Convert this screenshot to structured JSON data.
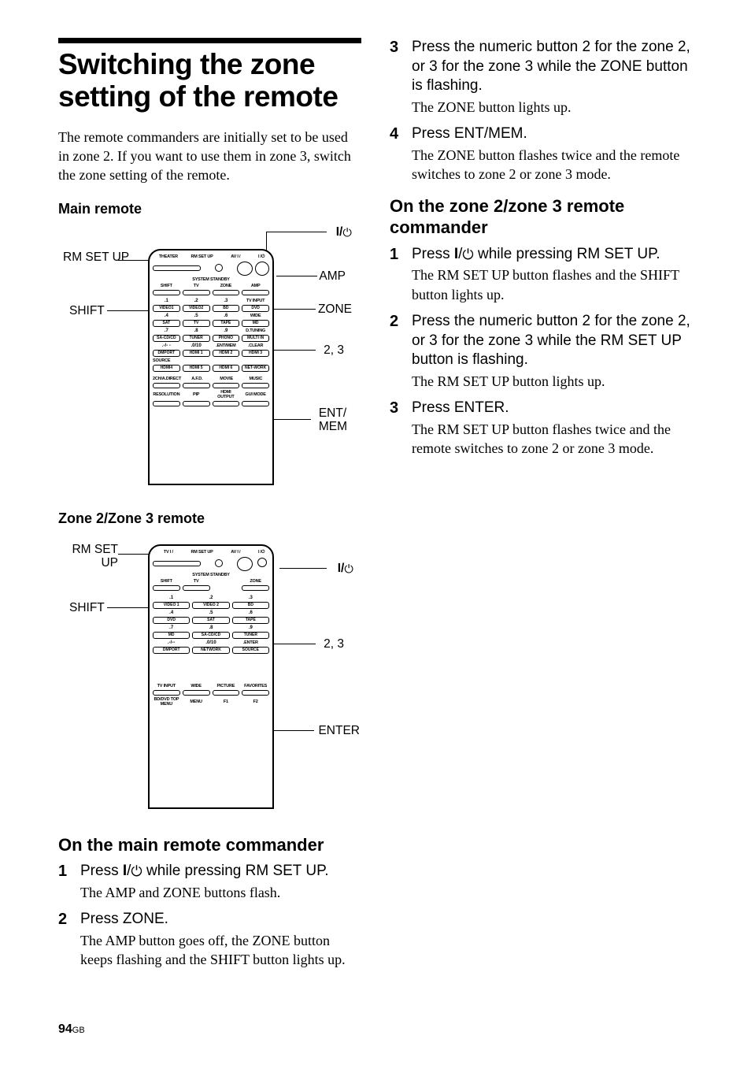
{
  "page_number": "94",
  "page_region": "GB",
  "left": {
    "title": "Switching the zone setting of the remote",
    "intro": "The remote commanders are initially set to be used in zone 2. If you want to use them in zone 3, switch the zone setting of the remote.",
    "main_remote_heading": "Main remote",
    "zone_remote_heading": "Zone 2/Zone 3 remote",
    "section_main_cmd": "On the main remote commander",
    "steps_main": [
      {
        "n": "1",
        "instr_pre": "Press ",
        "instr_bold": "I",
        "instr_post": "/",
        "instr_tail": " while pressing RM SET UP.",
        "result": "The AMP and ZONE buttons flash."
      },
      {
        "n": "2",
        "instr": "Press ZONE.",
        "result": "The AMP button goes off, the ZONE button keeps flashing and the SHIFT button lights up."
      }
    ],
    "fig1": {
      "labels": {
        "power": "I/",
        "rmsetup": "RM SET UP",
        "amp": "AMP",
        "shift": "SHIFT",
        "zone": "ZONE",
        "num": "2, 3",
        "entmem": "ENT/MEM"
      },
      "buttons": {
        "top_labels": [
          "THEATER",
          "RM SET UP",
          "AV I /",
          "SYSTEM STANDBY"
        ],
        "row_labels": [
          "SHIFT",
          "TV",
          "ZONE",
          "AMP"
        ],
        "nums": [
          ".1",
          ".2",
          ".3",
          "TV INPUT",
          "VIDEO1",
          "VIDEO2",
          "BD",
          "DVD",
          ".4",
          ".5",
          ".6",
          "WIDE",
          "SAT",
          "TV",
          "TAPE",
          "MD",
          ".7",
          ".8",
          ".9",
          "D.TUNING",
          "SA-CD/CD",
          "TUNER",
          "PHONO",
          "MULTI IN",
          ".-/- -",
          ".0/10",
          ".ENT/MEM",
          ".CLEAR",
          "DMPORT",
          "HDMI 1",
          "HDMI 2",
          "HDMI 3",
          "SOURCE",
          "HDMI4",
          "HDMI 5",
          "HDMI 6",
          "NET-WORK",
          "2CH/A.DIRECT",
          "A.F.D.",
          "MOVIE",
          "MUSIC",
          "RESOLUTION",
          "PIP",
          "HDMI OUTPUT",
          "GUI MODE"
        ]
      }
    },
    "fig2": {
      "labels": {
        "rmsetup": "RM SET UP",
        "power": "I/",
        "shift": "SHIFT",
        "num": "2, 3",
        "enter": "ENTER"
      },
      "buttons": {
        "top_labels": [
          "TV I /",
          "RM SET UP",
          "AV I /",
          "SYSTEM STANDBY"
        ],
        "row_labels": [
          "SHIFT",
          "TV",
          "",
          "ZONE"
        ],
        "nums": [
          ".1",
          ".2",
          ".3",
          "VIDEO 1",
          "VIDEO 2",
          "BD",
          ".4",
          ".5",
          ".6",
          "DVD",
          "SAT",
          "TAPE",
          ".7",
          ".8",
          ".9",
          "MD",
          "SA-CD/CD",
          "TUNER",
          ".-/--",
          ".0/10",
          ".ENTER",
          "DMPORT",
          "NETWORK",
          "SOURCE",
          "TV INPUT",
          "WIDE",
          "PICTURE",
          "FAVORITES",
          "BD/DVD TOP MENU",
          "MENU",
          "F1",
          "F2"
        ]
      }
    }
  },
  "right": {
    "steps_cont": [
      {
        "n": "3",
        "instr": "Press the numeric button 2 for the zone 2, or 3 for the zone 3 while the ZONE button is flashing.",
        "result": "The ZONE button lights up."
      },
      {
        "n": "4",
        "instr": "Press ENT/MEM.",
        "result": "The ZONE button flashes twice and the remote switches to zone 2 or zone 3 mode."
      }
    ],
    "section_zone_cmd": "On the zone 2/zone 3 remote commander",
    "steps_zone": [
      {
        "n": "1",
        "instr_pre": "Press ",
        "instr_bold": "I",
        "instr_post": "/",
        "instr_tail": " while pressing RM SET UP.",
        "result": "The RM SET UP button flashes and the SHIFT button lights up."
      },
      {
        "n": "2",
        "instr": "Press the numeric button 2 for the zone 2, or 3 for the zone 3 while the RM SET UP button is flashing.",
        "result": "The RM SET UP button lights up."
      },
      {
        "n": "3",
        "instr": "Press ENTER.",
        "result": "The RM SET UP button flashes twice and the remote switches to zone 2 or zone 3 mode."
      }
    ]
  }
}
